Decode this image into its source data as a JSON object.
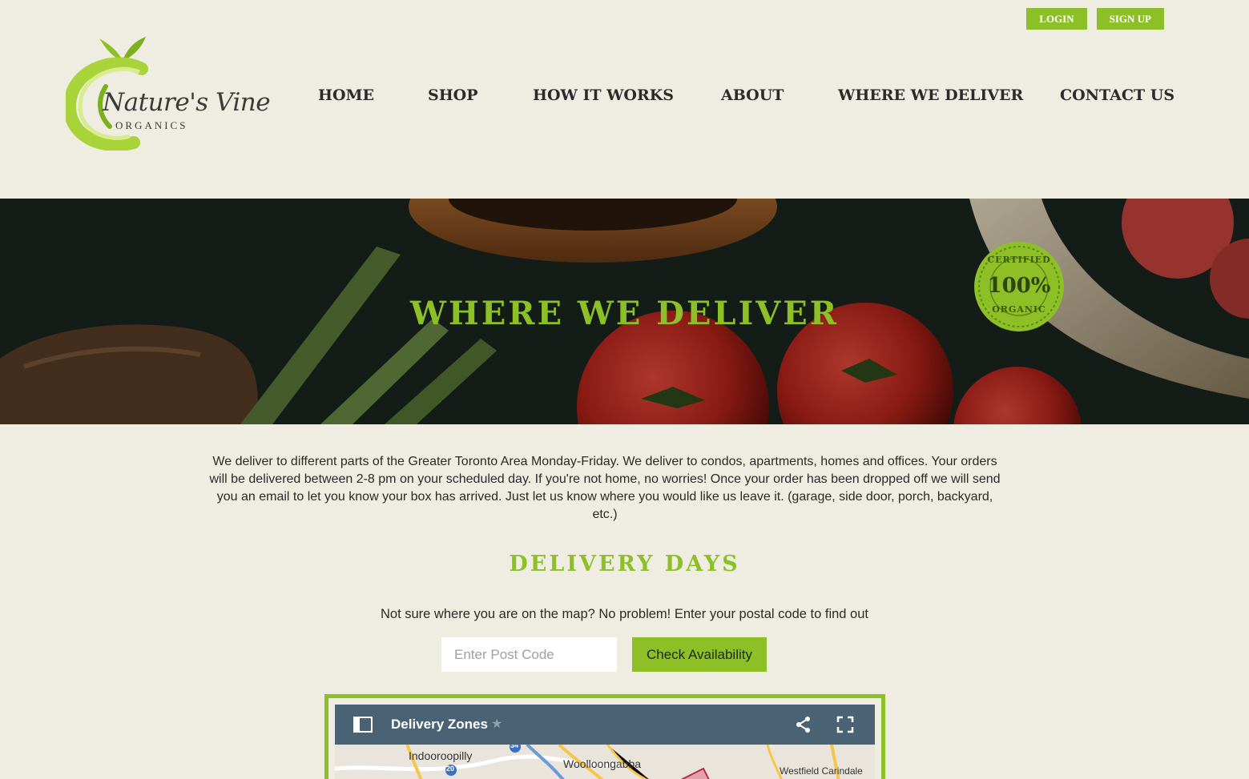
{
  "header": {
    "login_label": "LOGIN",
    "signup_label": "SIGN UP",
    "logo_title": "Nature's Vine",
    "logo_sub": "ORGANICS"
  },
  "nav": {
    "items": [
      "HOME",
      "SHOP",
      "HOW IT WORKS",
      "ABOUT",
      "WHERE WE DELIVER",
      "CONTACT US"
    ]
  },
  "hero": {
    "title": "WHERE WE DELIVER",
    "badge_top": "CERTIFIED",
    "badge_center": "100%",
    "badge_bottom": "ORGANIC"
  },
  "content": {
    "intro": "We deliver to different parts of the Greater Toronto Area Monday-Friday. We deliver to condos, apartments, homes and offices. Your orders will be delivered between 2-8 pm on your scheduled day. If you're not home, no worries! Once your order has been dropped off we will send you an email to let you know your box has arrived. Just let us know where you would like us leave it. (garage, side door, porch, backyard, etc.)",
    "section_title": "DELIVERY DAYS",
    "helper": "Not sure where you are on the map? No problem! Enter your postal code to find out",
    "postcode_placeholder": "Enter Post Code",
    "check_label": "Check Availability"
  },
  "map": {
    "title": "Delivery Zones",
    "star_icon": "star-icon",
    "labels": [
      "Indooroopilly",
      "Woolloongabba",
      "Westfield Carindale"
    ],
    "route_badges": [
      "34",
      "20"
    ],
    "colors": {
      "bar": "#4a6374",
      "frame": "#8dc026"
    }
  },
  "colors": {
    "accent": "#8dc026",
    "background": "#efece2",
    "text": "#2a2a2a"
  }
}
